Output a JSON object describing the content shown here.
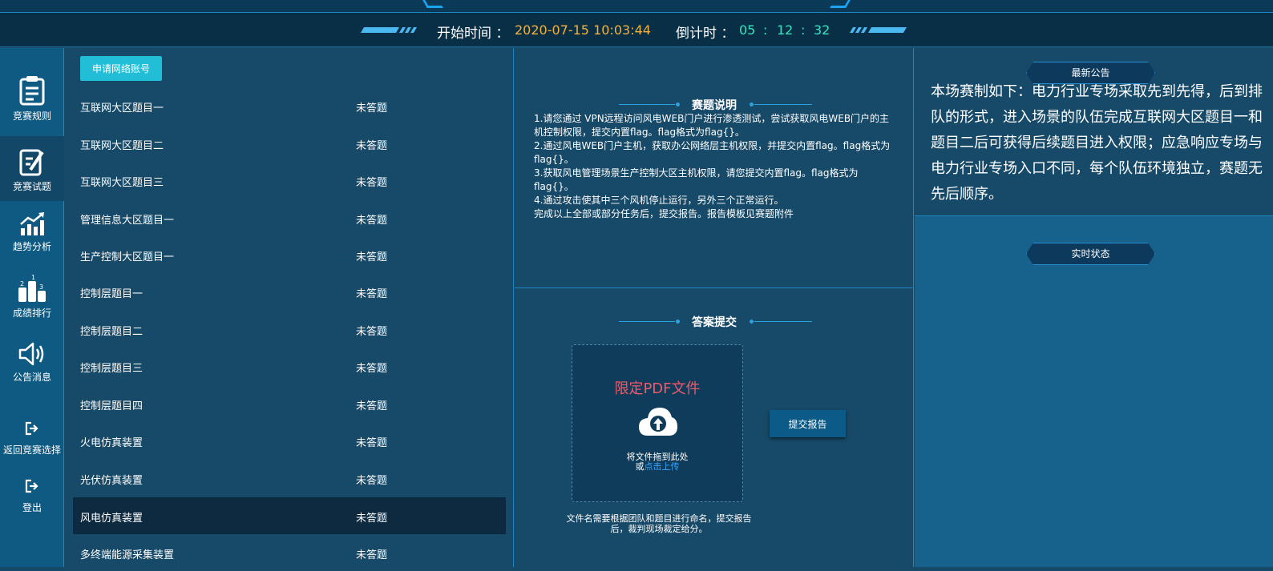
{
  "timer": {
    "start_label": "开始时间 ：",
    "start_time": "2020-07-15 10:03:44",
    "countdown_label": "倒计时 ：",
    "hours": "05",
    "minutes": "12",
    "seconds": "32",
    "sep": ":"
  },
  "nav": {
    "items": [
      {
        "label": "竞赛规则",
        "icon": "clipboard-icon"
      },
      {
        "label": "竞赛试题",
        "icon": "edit-document-icon"
      },
      {
        "label": "趋势分析",
        "icon": "trend-chart-icon"
      },
      {
        "label": "成绩排行",
        "icon": "podium-icon"
      },
      {
        "label": "公告消息",
        "icon": "speaker-icon"
      },
      {
        "label": "返回竞赛选择",
        "icon": "exit-icon"
      },
      {
        "label": "登出",
        "icon": "logout-icon"
      }
    ]
  },
  "list": {
    "apply_button": "申请网络账号",
    "rows": [
      {
        "name": "互联网大区题目一",
        "status": "未答题"
      },
      {
        "name": "互联网大区题目二",
        "status": "未答题"
      },
      {
        "name": "互联网大区题目三",
        "status": "未答题"
      },
      {
        "name": "管理信息大区题目一",
        "status": "未答题"
      },
      {
        "name": "生产控制大区题目一",
        "status": "未答题"
      },
      {
        "name": "控制层题目一",
        "status": "未答题"
      },
      {
        "name": "控制层题目二",
        "status": "未答题"
      },
      {
        "name": "控制层题目三",
        "status": "未答题"
      },
      {
        "name": "控制层题目四",
        "status": "未答题"
      },
      {
        "name": "火电仿真装置",
        "status": "未答题"
      },
      {
        "name": "光伏仿真装置",
        "status": "未答题"
      },
      {
        "name": "风电仿真装置",
        "status": "未答题"
      },
      {
        "name": "多终端能源采集装置",
        "status": "未答题"
      }
    ]
  },
  "description": {
    "title": "赛题说明",
    "lines": [
      "1.请您通过 VPN远程访问风电WEB门户进行渗透测试，尝试获取风电WEB门户的主机控制权限，提交内置flag。flag格式为flag{}。",
      "2.通过风电WEB门户主机，获取办公网络层主机权限，并提交内置flag。flag格式为flag{}。",
      "3.获取风电管理场景生产控制大区主机权限，请您提交内置flag。flag格式为flag{}。",
      "4.通过攻击使其中三个风机停止运行，另外三个正常运行。",
      "完成以上全部或部分任务后，提交报告。报告模板见赛题附件"
    ]
  },
  "submission": {
    "title": "答案提交",
    "limit_text": "限定PDF文件",
    "drag_hint": "将文件拖到此处",
    "or_text": "或",
    "upload_link": "点击上传",
    "submit_button": "提交报告",
    "file_note": "文件名需要根据团队和题目进行命名，提交报告后，裁判现场裁定给分。"
  },
  "announcement": {
    "title": "最新公告",
    "text": "本场赛制如下：电力行业专场采取先到先得，后到排队的形式，进入场景的队伍完成互联网大区题目一和题目二后可获得后续题目进入权限；应急响应专场与电力行业专场入口不同，每个队伍环境独立，赛题无先后顺序。"
  },
  "realtime": {
    "title": "实时状态"
  }
}
